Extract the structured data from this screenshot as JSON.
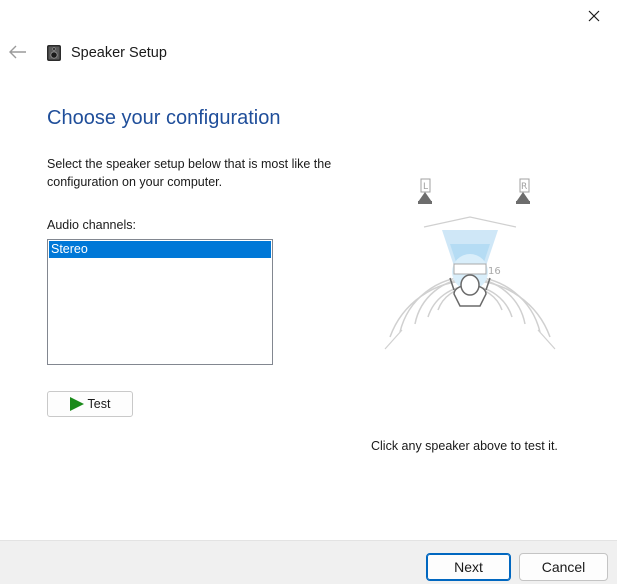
{
  "window": {
    "title": "Speaker Setup",
    "close_icon": "close-icon",
    "back_icon": "back-arrow-icon",
    "app_icon": "speaker-icon"
  },
  "main": {
    "heading": "Choose your configuration",
    "instructions": "Select the speaker setup below that is most like the configuration on your computer.",
    "channels_label": "Audio channels:",
    "channels": [
      {
        "label": "Stereo",
        "selected": true
      }
    ],
    "test_button": "Test",
    "hint": "Click any speaker above to test it."
  },
  "diagram": {
    "left_speaker_label": "L",
    "right_speaker_label": "R"
  },
  "footer": {
    "next_label": "Next",
    "cancel_label": "Cancel"
  },
  "colors": {
    "heading": "#1f4e9a",
    "selection": "#0078d7",
    "accent_border": "#0067c0",
    "play": "#1a8a1a"
  }
}
